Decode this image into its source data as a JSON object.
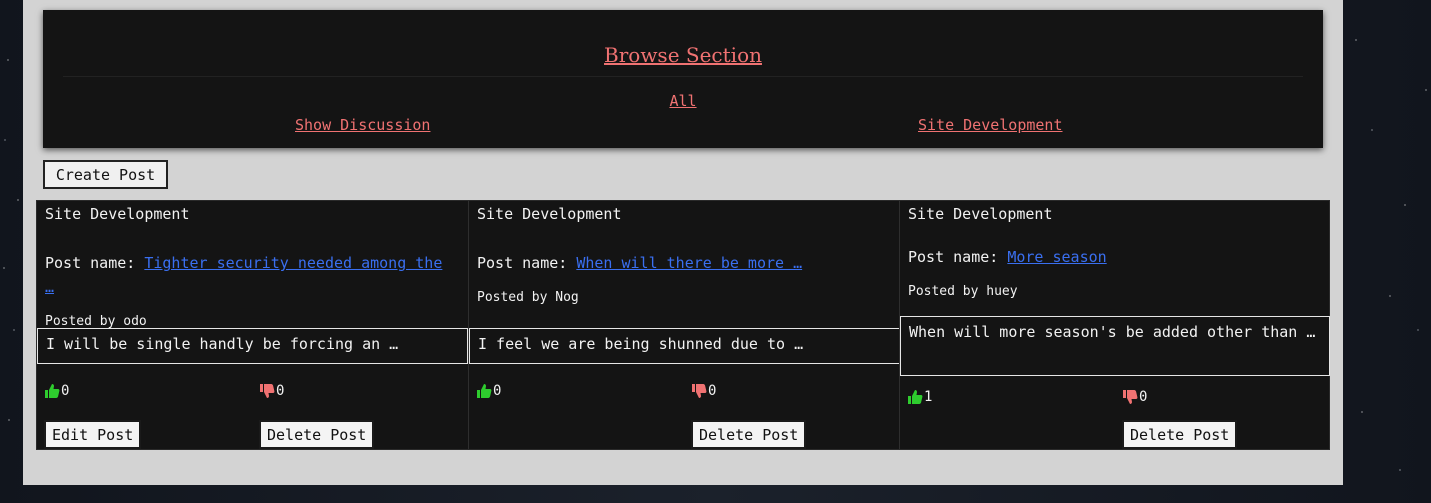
{
  "browse": {
    "title": "Browse Section",
    "all_label": "All",
    "categories": [
      "Show Discussion",
      "Site Development"
    ]
  },
  "create_post_label": "Create Post",
  "posts": [
    {
      "category": "Site Development",
      "name_label": "Post name:",
      "name": "Tighter security needed among the …",
      "posted_by": "Posted by odo",
      "excerpt": "I will be single handly be forcing an …",
      "likes": "0",
      "dislikes": "0",
      "edit_label": "Edit Post",
      "delete_label": "Delete Post"
    },
    {
      "category": "Site Development",
      "name_label": "Post name:",
      "name": "When will there be more …",
      "posted_by": "Posted by Nog",
      "excerpt": "I feel we are being shunned due to …",
      "likes": "0",
      "dislikes": "0",
      "delete_label": "Delete Post"
    },
    {
      "category": "Site Development",
      "name_label": "Post name:",
      "name": "More season",
      "posted_by": "Posted by huey",
      "excerpt": "When will more season's be added other than …",
      "likes": "1",
      "dislikes": "0",
      "delete_label": "Delete Post"
    }
  ],
  "colors": {
    "link_red": "#f07272",
    "link_blue": "#3a6ff0",
    "like_green": "#2ecc2e",
    "dislike_red": "#f07272",
    "card_bg": "#141414",
    "page_bg": "#d3d3d3"
  },
  "icons": {
    "like": "thumbs-up-icon",
    "dislike": "thumbs-down-icon"
  }
}
